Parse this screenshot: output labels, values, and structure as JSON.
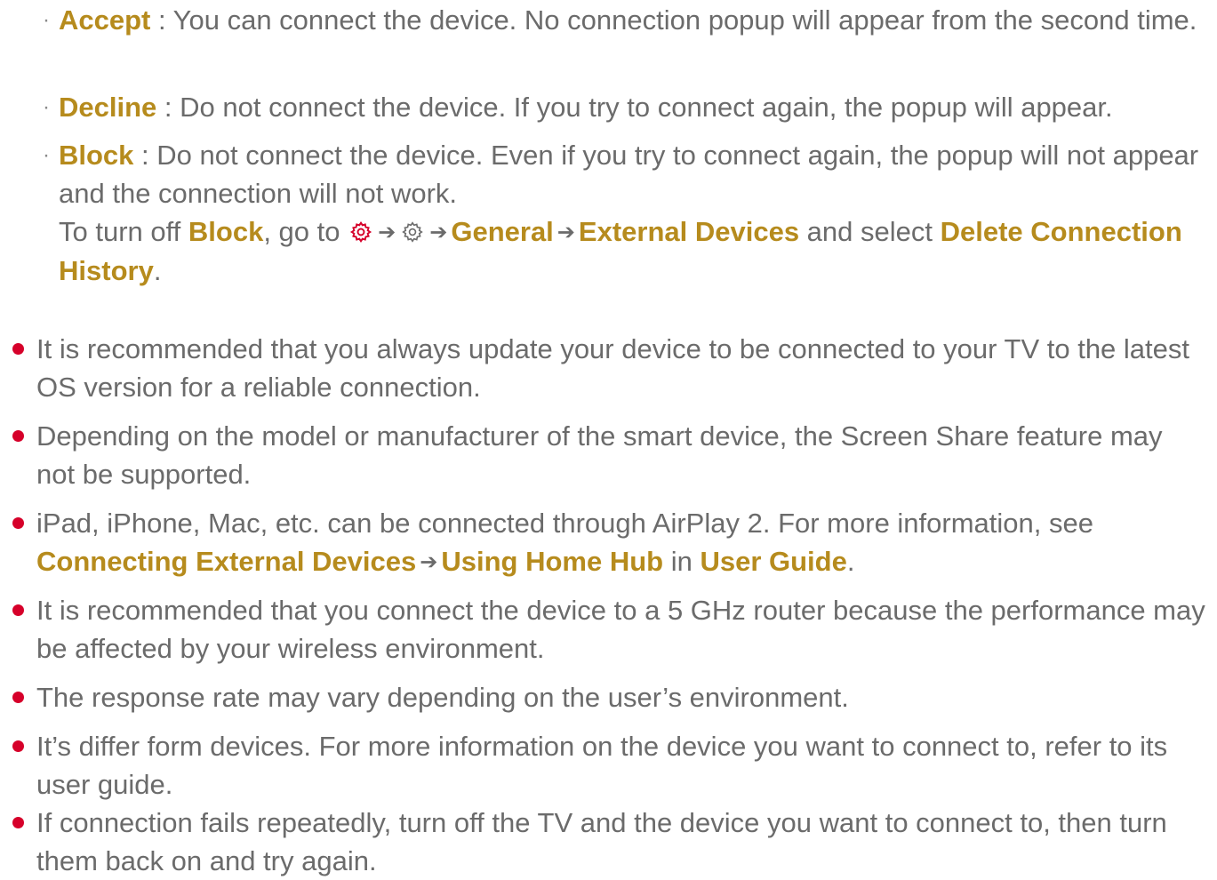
{
  "colors": {
    "highlight": "#b68b1d",
    "body_text": "#6b6b6b",
    "bullet": "#d6002a",
    "gear_red": "#d6002a"
  },
  "icons": [
    "gear-icon-red",
    "gear-icon-outline",
    "arrow-right-icon"
  ],
  "sub": {
    "bullet_char": "·",
    "sep": " : ",
    "accept_label": "Accept",
    "accept_text": "You can connect the device. No connection popup will appear from the second time.",
    "decline_label": "Decline",
    "decline_text": "Do not connect the device. If you try to connect again, the popup will appear.",
    "block_label": "Block",
    "block_text": "Do not connect the device. Even if you try to connect again, the popup will not appear and the connection will not work.",
    "turnoff_prefix": "To turn off ",
    "turnoff_block": "Block",
    "turnoff_go": ", go to ",
    "arrow": "➔",
    "general": "General",
    "external_devices": "External Devices",
    "and_select": " and select ",
    "delete_history": "Delete Connection History",
    "period": "."
  },
  "bullets": {
    "b1": "It is recommended that you always update your device to be connected to your TV to the latest OS version for a reliable connection.",
    "b2": "Depending on the model or manufacturer of the smart device, the Screen Share feature may not be supported.",
    "b3_text": "iPad, iPhone, Mac, etc. can be connected through AirPlay 2. For more information, see ",
    "b3_link1": "Connecting External Devices",
    "b3_link2": "Using Home Hub",
    "b3_in": " in ",
    "b3_link3": "User Guide",
    "b3_end": ".",
    "b4": "It is recommended that you connect the device to a 5 GHz router because the performance may be affected by your wireless environment.",
    "b5": "The response rate may vary depending on the user’s environment.",
    "b6": "It’s differ form devices. For more information on the device you want to connect to, refer to its user guide.",
    "b7": "If connection fails repeatedly, turn off the TV and the device you want to connect to, then turn them back on and try again."
  }
}
